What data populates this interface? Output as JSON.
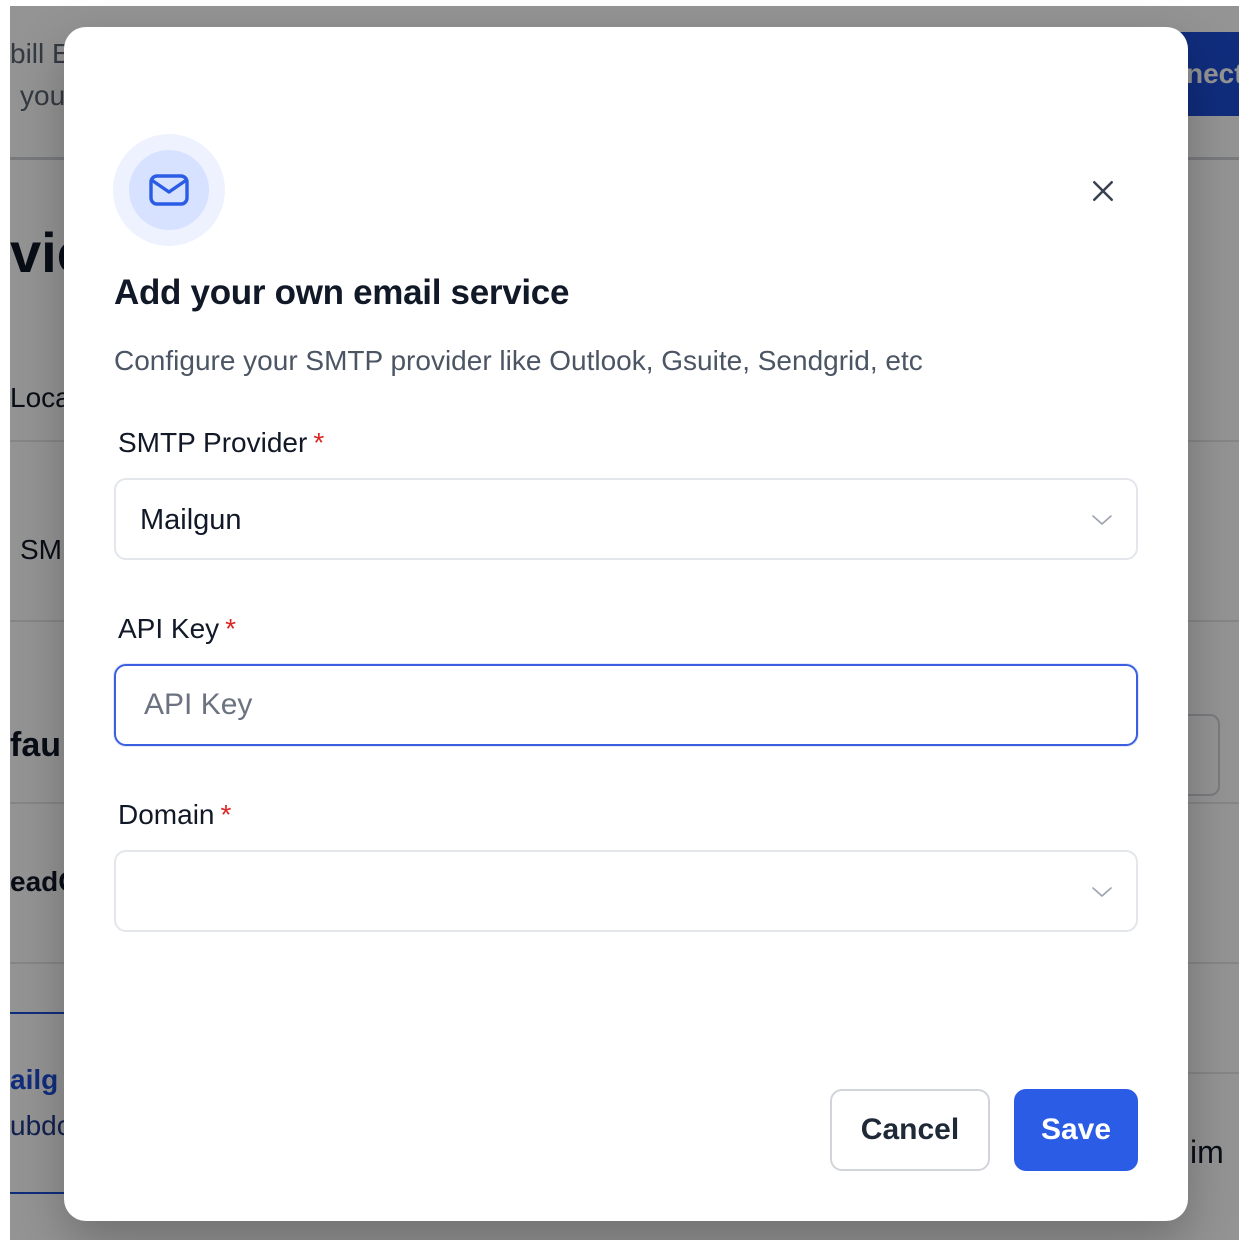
{
  "background": {
    "fragments": [
      "bill E",
      "you",
      "vic",
      "Loca",
      "SM",
      "fau",
      "eadC",
      "ailg",
      "ubdc",
      "im"
    ],
    "connect_label": "nect"
  },
  "modal": {
    "icon": "mail-icon",
    "title": "Add your own email service",
    "subtitle": "Configure your SMTP provider like Outlook, Gsuite, Sendgrid, etc",
    "close_icon": "close-icon",
    "fields": {
      "smtp_provider": {
        "label": "SMTP Provider",
        "required_mark": "*",
        "value": "Mailgun"
      },
      "api_key": {
        "label": "API Key",
        "required_mark": "*",
        "value": "",
        "placeholder": "API Key"
      },
      "domain": {
        "label": "Domain",
        "required_mark": "*",
        "value": ""
      }
    },
    "buttons": {
      "cancel": "Cancel",
      "save": "Save"
    }
  },
  "colors": {
    "accent": "#2b5ce6",
    "required": "#dc2626",
    "focus_border": "#3b5fe0",
    "overlay": "rgba(0,0,0,0.42)"
  }
}
